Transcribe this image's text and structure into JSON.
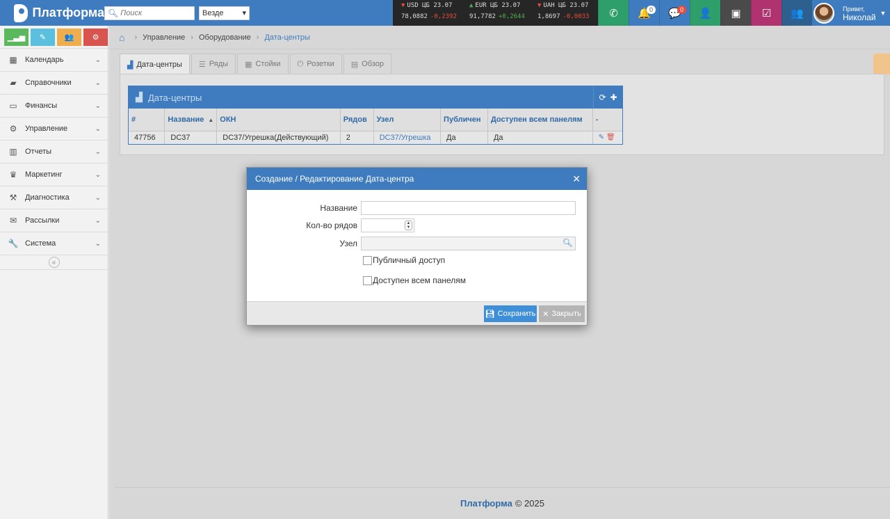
{
  "app": {
    "title": "Платформа",
    "search_placeholder": "Поиск",
    "scope": "Везде"
  },
  "rates": [
    {
      "label": "USD ЦБ 23.07",
      "value": "78,0882",
      "delta": "-0,2392",
      "dir": "down"
    },
    {
      "label": "EUR ЦБ 23.07",
      "value": "91,7782",
      "delta": "+0,2644",
      "dir": "up"
    },
    {
      "label": "UAH ЦБ 23.07",
      "value": "1,8697",
      "delta": "-0,0033",
      "dir": "down"
    }
  ],
  "topbar_buttons": [
    {
      "name": "phone-icon",
      "glyph": "✆",
      "color": "#2e9e6a",
      "badge": ""
    },
    {
      "name": "bell-icon",
      "glyph": "🔔",
      "color": "#3f7cbf",
      "badge": "0"
    },
    {
      "name": "chat-icon",
      "glyph": "💬",
      "color": "#3f7cbf",
      "badge": "0"
    },
    {
      "name": "user-icon",
      "glyph": "👤",
      "color": "#2e9e6a",
      "badge": ""
    },
    {
      "name": "contacts-icon",
      "glyph": "▣",
      "color": "#4a4a4a",
      "badge": ""
    },
    {
      "name": "checklist-icon",
      "glyph": "☑",
      "color": "#b0336f",
      "badge": ""
    },
    {
      "name": "group-icon",
      "glyph": "👥",
      "color": "#2d5f8f",
      "badge": ""
    }
  ],
  "user": {
    "greeting": "Привет,",
    "name": "Николай"
  },
  "sidebar": {
    "shortcuts": [
      {
        "name": "stats-shortcut",
        "glyph": "▁▃▅",
        "color": "#5cb85c"
      },
      {
        "name": "edit-shortcut",
        "glyph": "✎",
        "color": "#5bc0de"
      },
      {
        "name": "users-shortcut",
        "glyph": "👥",
        "color": "#f0ad4e"
      },
      {
        "name": "settings-shortcut",
        "glyph": "⚙",
        "color": "#d9534f"
      }
    ],
    "items": [
      {
        "label": "Календарь",
        "icon": "calendar-icon",
        "glyph": "▦"
      },
      {
        "label": "Справочники",
        "icon": "book-icon",
        "glyph": "▰"
      },
      {
        "label": "Финансы",
        "icon": "money-icon",
        "glyph": "▭"
      },
      {
        "label": "Управление",
        "icon": "cogs-icon",
        "glyph": "⚙"
      },
      {
        "label": "Отчеты",
        "icon": "bar-chart-icon",
        "glyph": "▥"
      },
      {
        "label": "Маркетинг",
        "icon": "trophy-icon",
        "glyph": "♛"
      },
      {
        "label": "Диагностика",
        "icon": "gavel-icon",
        "glyph": "⚒"
      },
      {
        "label": "Рассылки",
        "icon": "envelope-icon",
        "glyph": "✉"
      },
      {
        "label": "Система",
        "icon": "wrench-icon",
        "glyph": "🔧"
      }
    ]
  },
  "breadcrumb": {
    "items": [
      "Управление",
      "Оборудование"
    ],
    "current": "Дата-центры"
  },
  "tabs": [
    {
      "label": "Дата-центры",
      "glyph": "▟",
      "active": true
    },
    {
      "label": "Ряды",
      "glyph": "☰",
      "active": false
    },
    {
      "label": "Стойки",
      "glyph": "▦",
      "active": false
    },
    {
      "label": "Розетки",
      "glyph": "⏻",
      "active": false
    },
    {
      "label": "Обзор",
      "glyph": "▤",
      "active": false
    }
  ],
  "datacenters": {
    "title": "Дата-центры",
    "columns": [
      "#",
      "Название",
      "ОКН",
      "Рядов",
      "Узел",
      "Публичен",
      "Доступен всем панелям",
      "-"
    ],
    "rows": [
      [
        "47756",
        "DC37",
        "DC37/Угрешка(Действующий)",
        "2",
        "DC37/Угрешка",
        "Да",
        "Да"
      ]
    ]
  },
  "modal": {
    "title": "Создание / Редактирование Дата-центра",
    "fields": {
      "name_label": "Название",
      "rows_label": "Кол-во рядов",
      "node_label": "Узел",
      "public_label": "Публичный доступ",
      "all_panels_label": "Доступен всем панелям"
    },
    "save_label": "Сохранить",
    "close_label": "Закрыть"
  },
  "footer": {
    "brand": "Платформа",
    "copyright": "© 2025"
  }
}
